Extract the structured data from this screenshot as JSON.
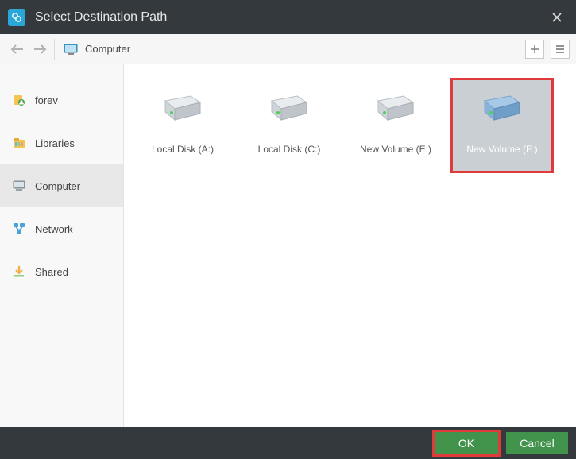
{
  "titlebar": {
    "title": "Select Destination Path"
  },
  "toolbar": {
    "breadcrumb": "Computer"
  },
  "sidebar": {
    "items": [
      {
        "label": "forev"
      },
      {
        "label": "Libraries"
      },
      {
        "label": "Computer"
      },
      {
        "label": "Network"
      },
      {
        "label": "Shared"
      }
    ]
  },
  "drives": [
    {
      "label": "Local Disk (A:)",
      "selected": false
    },
    {
      "label": "Local Disk (C:)",
      "selected": false
    },
    {
      "label": "New Volume (E:)",
      "selected": false
    },
    {
      "label": "New Volume (F:)",
      "selected": true
    }
  ],
  "footer": {
    "ok": "OK",
    "cancel": "Cancel"
  },
  "colors": {
    "accent_green": "#41924a",
    "highlight_red": "#e03a3a",
    "titlebar_bg": "#33393d"
  }
}
